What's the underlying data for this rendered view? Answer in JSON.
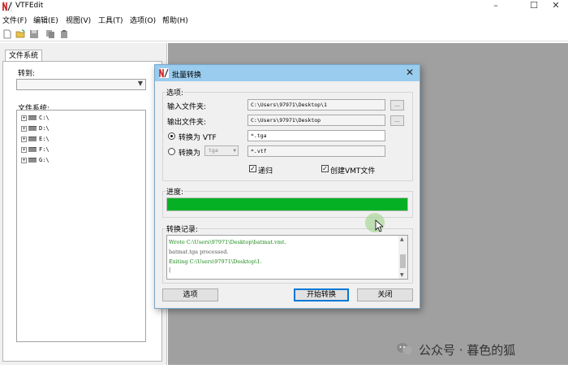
{
  "app": {
    "title": "VTFEdit",
    "window_controls": {
      "minimize": "–",
      "maximize": "☐",
      "close": "✕"
    }
  },
  "menubar": {
    "items": [
      "文件(F)",
      "编辑(E)",
      "视图(V)",
      "工具(T)",
      "选项(O)",
      "帮助(H)"
    ]
  },
  "toolbar": {
    "icons": [
      "new-file-icon",
      "open-folder-icon",
      "save-icon",
      "copy-icon",
      "paste-icon"
    ]
  },
  "left_panel": {
    "tab": "文件系统",
    "goto_label": "转到:",
    "goto_value": "",
    "filesystem_label": "文件系统:",
    "drives": [
      "C:\\",
      "D:\\",
      "E:\\",
      "F:\\",
      "G:\\"
    ]
  },
  "dialog": {
    "title": "批量转换",
    "options_group": "选项:",
    "input_folder_label": "输入文件夹:",
    "input_folder_value": "C:\\Users\\97971\\Desktop\\1",
    "output_folder_label": "输出文件夹:",
    "output_folder_value": "C:\\Users\\97971\\Desktop",
    "browse_label": "...",
    "convert_to_vtf_label": "转换为 VTF",
    "convert_to_vtf_filter": "*.tga",
    "convert_to_other_label": "转换为",
    "convert_to_other_format": "tga",
    "convert_to_other_filter": "*.vtf",
    "recursive_label": "递归",
    "create_vmt_label": "创建VMT文件",
    "recursive_checked": true,
    "create_vmt_checked": true,
    "progress_label": "进度:",
    "progress_fraction": 1.0,
    "log_label": "转换记录:",
    "log_lines": [
      {
        "text": "Wrote C:\\Users\\97971\\Desktop\\batmat.vmt.",
        "color": "#1a8a1a"
      },
      {
        "text": "batmat.tga processed.",
        "color": "#555555"
      },
      {
        "text": "Exiting C:\\Users\\97971\\Desktop\\1.",
        "color": "#1a8a1a"
      }
    ],
    "options_button": "选项",
    "start_button": "开始转换",
    "close_button": "关闭"
  },
  "watermark": {
    "text": "公众号 · 暮色的狐"
  },
  "colors": {
    "dialog_title_bg": "#99ccee",
    "progress_fill": "#06b025",
    "workspace_bg": "#a0a0a0"
  }
}
